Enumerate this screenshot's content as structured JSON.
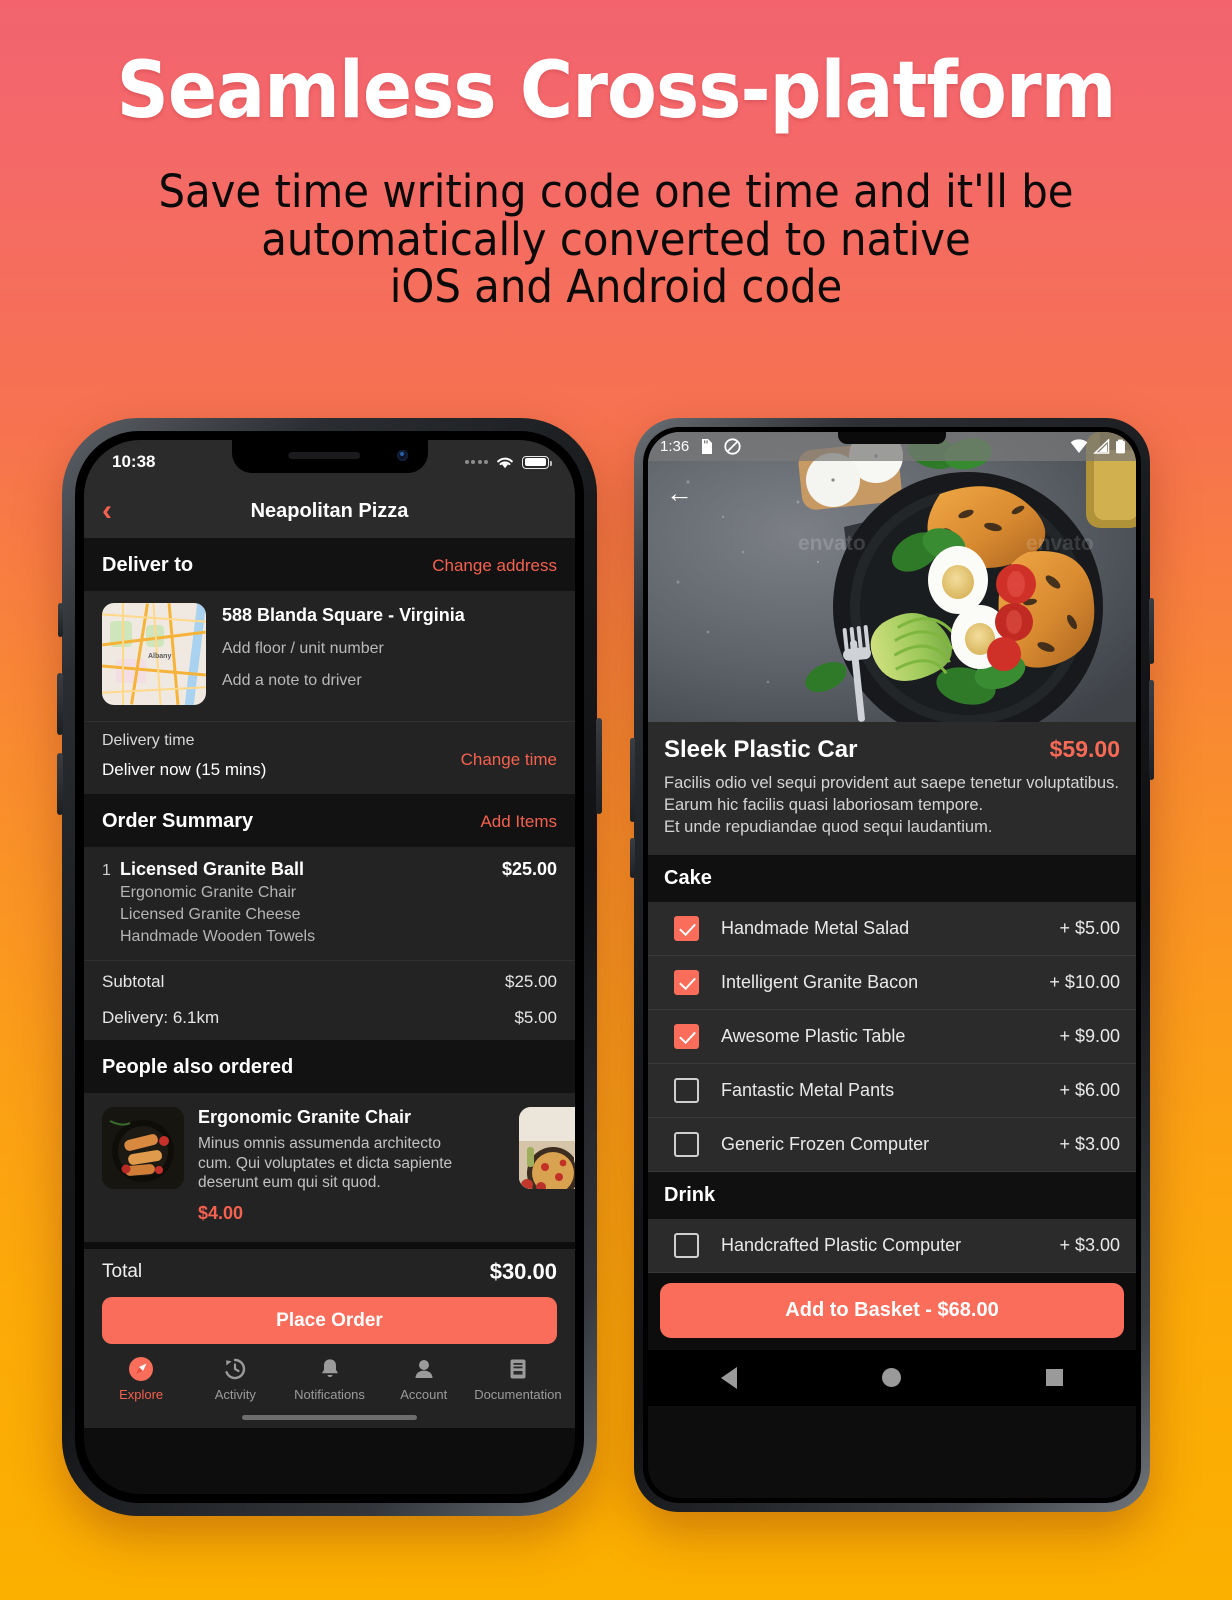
{
  "hero": {
    "title": "Seamless Cross-platform",
    "subtitle_line1": "Save time writing code one time and it'll be",
    "subtitle_line2": "automatically converted to native",
    "subtitle_line3": "iOS and Android code"
  },
  "colors": {
    "accent": "#fa6d5a",
    "accent_text": "#f4614f",
    "android_price": "#f96a56",
    "bg_top": "#f2636e",
    "bg_bottom": "#fbb000",
    "panel": "#232323",
    "panel_dark": "#121212",
    "screen_bg": "#0d0d0d"
  },
  "iphone": {
    "status": {
      "time": "10:38",
      "wifi_icon": "wifi-icon",
      "battery_icon": "battery-icon",
      "signal_icon": "signal-dots-icon"
    },
    "navbar": {
      "back_icon": "chevron-left-icon",
      "title": "Neapolitan Pizza"
    },
    "deliver_to": {
      "heading": "Deliver to",
      "action": "Change address",
      "map_icon": "map-thumbnail",
      "map_label": "Albany",
      "address": "588 Blanda Square - Virginia",
      "floor_placeholder": "Add floor / unit number",
      "note_placeholder": "Add a note to driver"
    },
    "delivery_time": {
      "label": "Delivery time",
      "value": "Deliver now (15 mins)",
      "action": "Change time"
    },
    "order_summary": {
      "heading": "Order Summary",
      "action": "Add Items",
      "items": [
        {
          "qty": "1",
          "name": "Licensed Granite Ball",
          "price": "$25.00",
          "options": [
            "Ergonomic Granite Chair",
            "Licensed Granite Cheese",
            "Handmade Wooden Towels"
          ]
        }
      ],
      "totals": [
        {
          "label": "Subtotal",
          "value": "$25.00"
        },
        {
          "label": "Delivery: 6.1km",
          "value": "$5.00"
        }
      ]
    },
    "people_also_ordered": {
      "heading": "People also ordered",
      "cards": [
        {
          "name": "Ergonomic Granite Chair",
          "desc": "Minus omnis assumenda architecto cum. Qui voluptates et dicta sapiente deserunt eum qui sit quod.",
          "price": "$4.00",
          "image_icon": "grilled-food-photo"
        },
        {
          "image_icon": "pizza-photo"
        }
      ]
    },
    "footer": {
      "total_label": "Total",
      "total_value": "$30.00",
      "place_order": "Place Order"
    },
    "tabbar": [
      {
        "label": "Explore",
        "icon": "compass-icon",
        "active": true
      },
      {
        "label": "Activity",
        "icon": "clock-history-icon",
        "active": false
      },
      {
        "label": "Notifications",
        "icon": "bell-icon",
        "active": false
      },
      {
        "label": "Account",
        "icon": "person-icon",
        "active": false
      },
      {
        "label": "Documentation",
        "icon": "book-icon",
        "active": false
      }
    ]
  },
  "android": {
    "status": {
      "time": "1:36",
      "icons": [
        "sd-card-icon",
        "do-not-disturb-icon"
      ],
      "right_icons": [
        "wifi-icon",
        "cell-signal-icon",
        "battery-icon"
      ]
    },
    "hero": {
      "back_icon": "arrow-left-icon",
      "image_icon": "chicken-avocado-salad-photo",
      "watermark": "envato"
    },
    "product": {
      "title": "Sleek Plastic Car",
      "price": "$59.00",
      "desc_line1": "Facilis odio vel sequi provident aut saepe tenetur voluptatibus.",
      "desc_line2": "Earum hic facilis quasi laboriosam tempore.",
      "desc_line3": "Et unde repudiandae quod sequi laudantium."
    },
    "groups": [
      {
        "heading": "Cake",
        "options": [
          {
            "name": "Handmade Metal Salad",
            "price": "+ $5.00",
            "checked": true
          },
          {
            "name": "Intelligent Granite Bacon",
            "price": "+ $10.00",
            "checked": true
          },
          {
            "name": "Awesome Plastic Table",
            "price": "+ $9.00",
            "checked": true
          },
          {
            "name": "Fantastic Metal Pants",
            "price": "+ $6.00",
            "checked": false
          },
          {
            "name": "Generic Frozen Computer",
            "price": "+ $3.00",
            "checked": false
          }
        ]
      },
      {
        "heading": "Drink",
        "options": [
          {
            "name": "Handcrafted Plastic Computer",
            "price": "+ $3.00",
            "checked": false
          }
        ]
      }
    ],
    "basket_button": "Add to Basket - $68.00",
    "navbar": [
      {
        "icon": "back-triangle-icon"
      },
      {
        "icon": "home-circle-icon"
      },
      {
        "icon": "recents-square-icon"
      }
    ]
  }
}
